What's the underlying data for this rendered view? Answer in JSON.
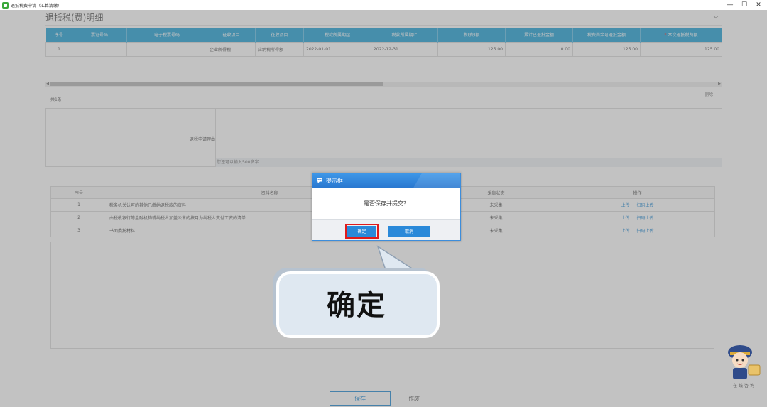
{
  "window": {
    "title": "退抵税费申请（汇算清缴）",
    "controls": [
      "—",
      "☐",
      "✕"
    ]
  },
  "section": {
    "title": "退抵税(费)明细"
  },
  "refund_table": {
    "headers": [
      "序号",
      "票证号码",
      "电子税票号码",
      "征收项目",
      "征收品目",
      "税款所属期起",
      "税款所属期止",
      "税(费)额",
      "累计已退抵金额",
      "税费尚余可退抵金额",
      "本次退抵税费额"
    ],
    "required_mark": "*",
    "rows": [
      [
        "1",
        "",
        "",
        "企业所得税",
        "应纳税所得额",
        "2022-01-01",
        "2022-12-31",
        "125.00",
        "0.00",
        "125.00",
        "125.00"
      ]
    ]
  },
  "total_text": "共1条",
  "delete_label": "删除",
  "reason": {
    "label": "退税申请理由",
    "hint": "您还可以输入500多字"
  },
  "doc_table": {
    "headers": [
      "序号",
      "资料名称",
      "采集状态",
      "操作"
    ],
    "rows": [
      {
        "no": "1",
        "name": "税务机关认可的其他已缴纳退税款的资料",
        "status": "未采集",
        "ops": [
          "上传",
          "扫码上传"
        ]
      },
      {
        "no": "2",
        "name": "由税收银行等金融机构或纳税人加盖公章的按月为纳税人支付工资的清单",
        "status": "未采集",
        "ops": [
          "上传",
          "扫码上传"
        ]
      },
      {
        "no": "3",
        "name": "书面委托材料",
        "status": "未采集",
        "ops": [
          "上传",
          "扫码上传"
        ]
      }
    ]
  },
  "footer": {
    "save_label": "保存",
    "void_label": "作废"
  },
  "dialog": {
    "title": "提示框",
    "message": "是否保存并提交？",
    "ok_label": "确定",
    "cancel_label": "取消"
  },
  "callout": {
    "text": "确定"
  },
  "mascot": {
    "caption": "在线咨询"
  },
  "colors": {
    "table_header": "#2aa6d8",
    "dialog_header": "#2a78d0",
    "button_primary": "#2a89d9",
    "highlight_red": "#e01b1b",
    "link": "#2a8fd6"
  }
}
